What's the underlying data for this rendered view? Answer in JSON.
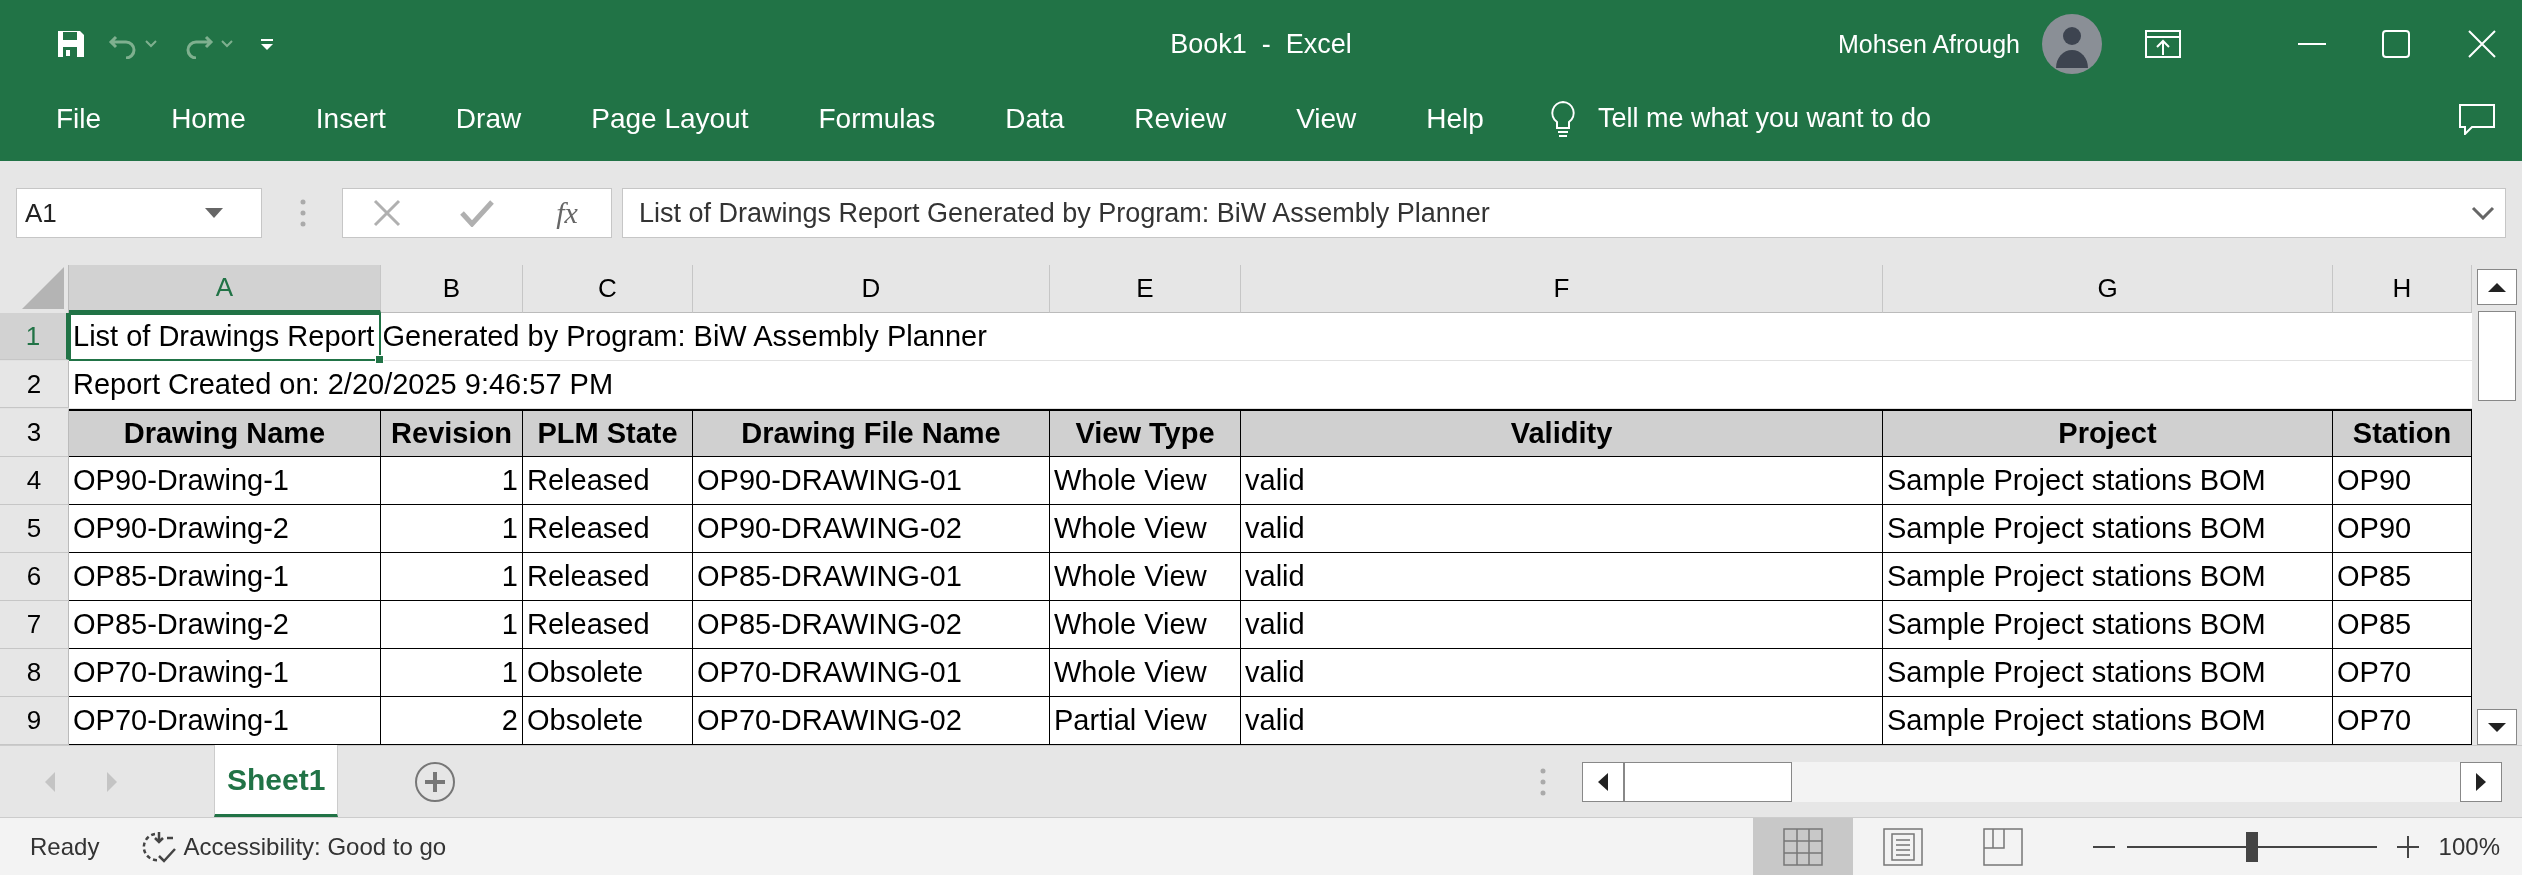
{
  "window": {
    "title": "Book1  -  Excel",
    "user": "Mohsen Afrough"
  },
  "ribbon_tabs": [
    "File",
    "Home",
    "Insert",
    "Draw",
    "Page Layout",
    "Formulas",
    "Data",
    "Review",
    "View",
    "Help"
  ],
  "tell_me": {
    "placeholder": "Tell me what you want to do"
  },
  "name_box": {
    "value": "A1"
  },
  "formula_bar": {
    "function_label": "fx",
    "value": "List of Drawings Report Generated by Program: BiW Assembly Planner"
  },
  "columns": [
    {
      "label": "A",
      "selected": true
    },
    {
      "label": "B",
      "selected": false
    },
    {
      "label": "C",
      "selected": false
    },
    {
      "label": "D",
      "selected": false
    },
    {
      "label": "E",
      "selected": false
    },
    {
      "label": "F",
      "selected": false
    },
    {
      "label": "G",
      "selected": false
    },
    {
      "label": "H",
      "selected": false
    }
  ],
  "row_numbers": [
    {
      "label": "1",
      "selected": true
    },
    {
      "label": "2",
      "selected": false
    },
    {
      "label": "3",
      "selected": false
    },
    {
      "label": "4",
      "selected": false
    },
    {
      "label": "5",
      "selected": false
    },
    {
      "label": "6",
      "selected": false
    },
    {
      "label": "7",
      "selected": false
    },
    {
      "label": "8",
      "selected": false
    },
    {
      "label": "9",
      "selected": false
    }
  ],
  "sheet": {
    "title_rows": [
      "List of Drawings Report Generated by Program: BiW Assembly Planner",
      "Report Created on: 2/20/2025 9:46:57 PM"
    ],
    "header": [
      "Drawing Name",
      "Revision",
      "PLM State",
      "Drawing File Name",
      "View Type",
      "Validity",
      "Project",
      "Station"
    ],
    "rows": [
      [
        "OP90-Drawing-1",
        "1",
        "Released",
        "OP90-DRAWING-01",
        "Whole View",
        "valid",
        "Sample Project stations BOM",
        "OP90"
      ],
      [
        "OP90-Drawing-2",
        "1",
        "Released",
        "OP90-DRAWING-02",
        "Whole View",
        "valid",
        "Sample Project stations BOM",
        "OP90"
      ],
      [
        "OP85-Drawing-1",
        "1",
        "Released",
        "OP85-DRAWING-01",
        "Whole View",
        "valid",
        "Sample Project stations BOM",
        "OP85"
      ],
      [
        "OP85-Drawing-2",
        "1",
        "Released",
        "OP85-DRAWING-02",
        "Whole View",
        "valid",
        "Sample Project stations BOM",
        "OP85"
      ],
      [
        "OP70-Drawing-1",
        "1",
        "Obsolete",
        "OP70-DRAWING-01",
        "Whole View",
        "valid",
        "Sample Project stations BOM",
        "OP70"
      ],
      [
        "OP70-Drawing-1",
        "2",
        "Obsolete",
        "OP70-DRAWING-02",
        "Partial View",
        "valid",
        "Sample Project stations BOM",
        "OP70"
      ]
    ]
  },
  "sheet_tabs": [
    {
      "label": "Sheet1",
      "selected": true
    }
  ],
  "status_bar": {
    "mode": "Ready",
    "accessibility": "Accessibility: Good to go",
    "views": [
      {
        "kind": "normal",
        "selected": true
      },
      {
        "kind": "page_layout",
        "selected": false
      },
      {
        "kind": "page_break",
        "selected": false
      }
    ],
    "zoom": {
      "level": 0.5,
      "reading": "100%"
    }
  }
}
